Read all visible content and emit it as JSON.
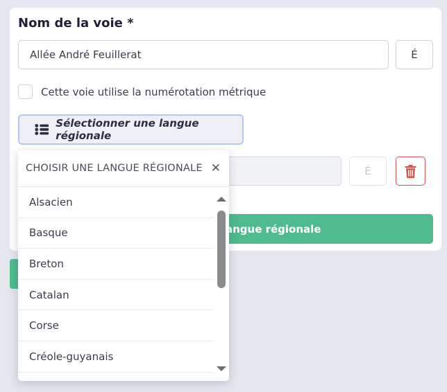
{
  "form": {
    "street_name_label": "Nom de la voie *",
    "street_name_value": "Allée André Feuillerat",
    "accent_button_label": "É",
    "metric_checkbox_label": "Cette voie utilise la numérotation métrique",
    "select_language_button_label": "Sélectionner une langue régionale",
    "regional_name_accent_label": "É",
    "add_language_button_label": "angue régionale"
  },
  "dropdown": {
    "title": "CHOISIR UNE LANGUE RÉGIONALE",
    "close_symbol": "✕",
    "options": [
      "Alsacien",
      "Basque",
      "Breton",
      "Catalan",
      "Corse",
      "Créole-guyanais"
    ]
  },
  "colors": {
    "accent_green": "#50bb8e",
    "danger_red": "#d9534f",
    "focus_blue": "#b7c7f7"
  },
  "icons": {
    "select_language": "list-icon",
    "delete": "trash-icon",
    "close": "close-icon"
  }
}
